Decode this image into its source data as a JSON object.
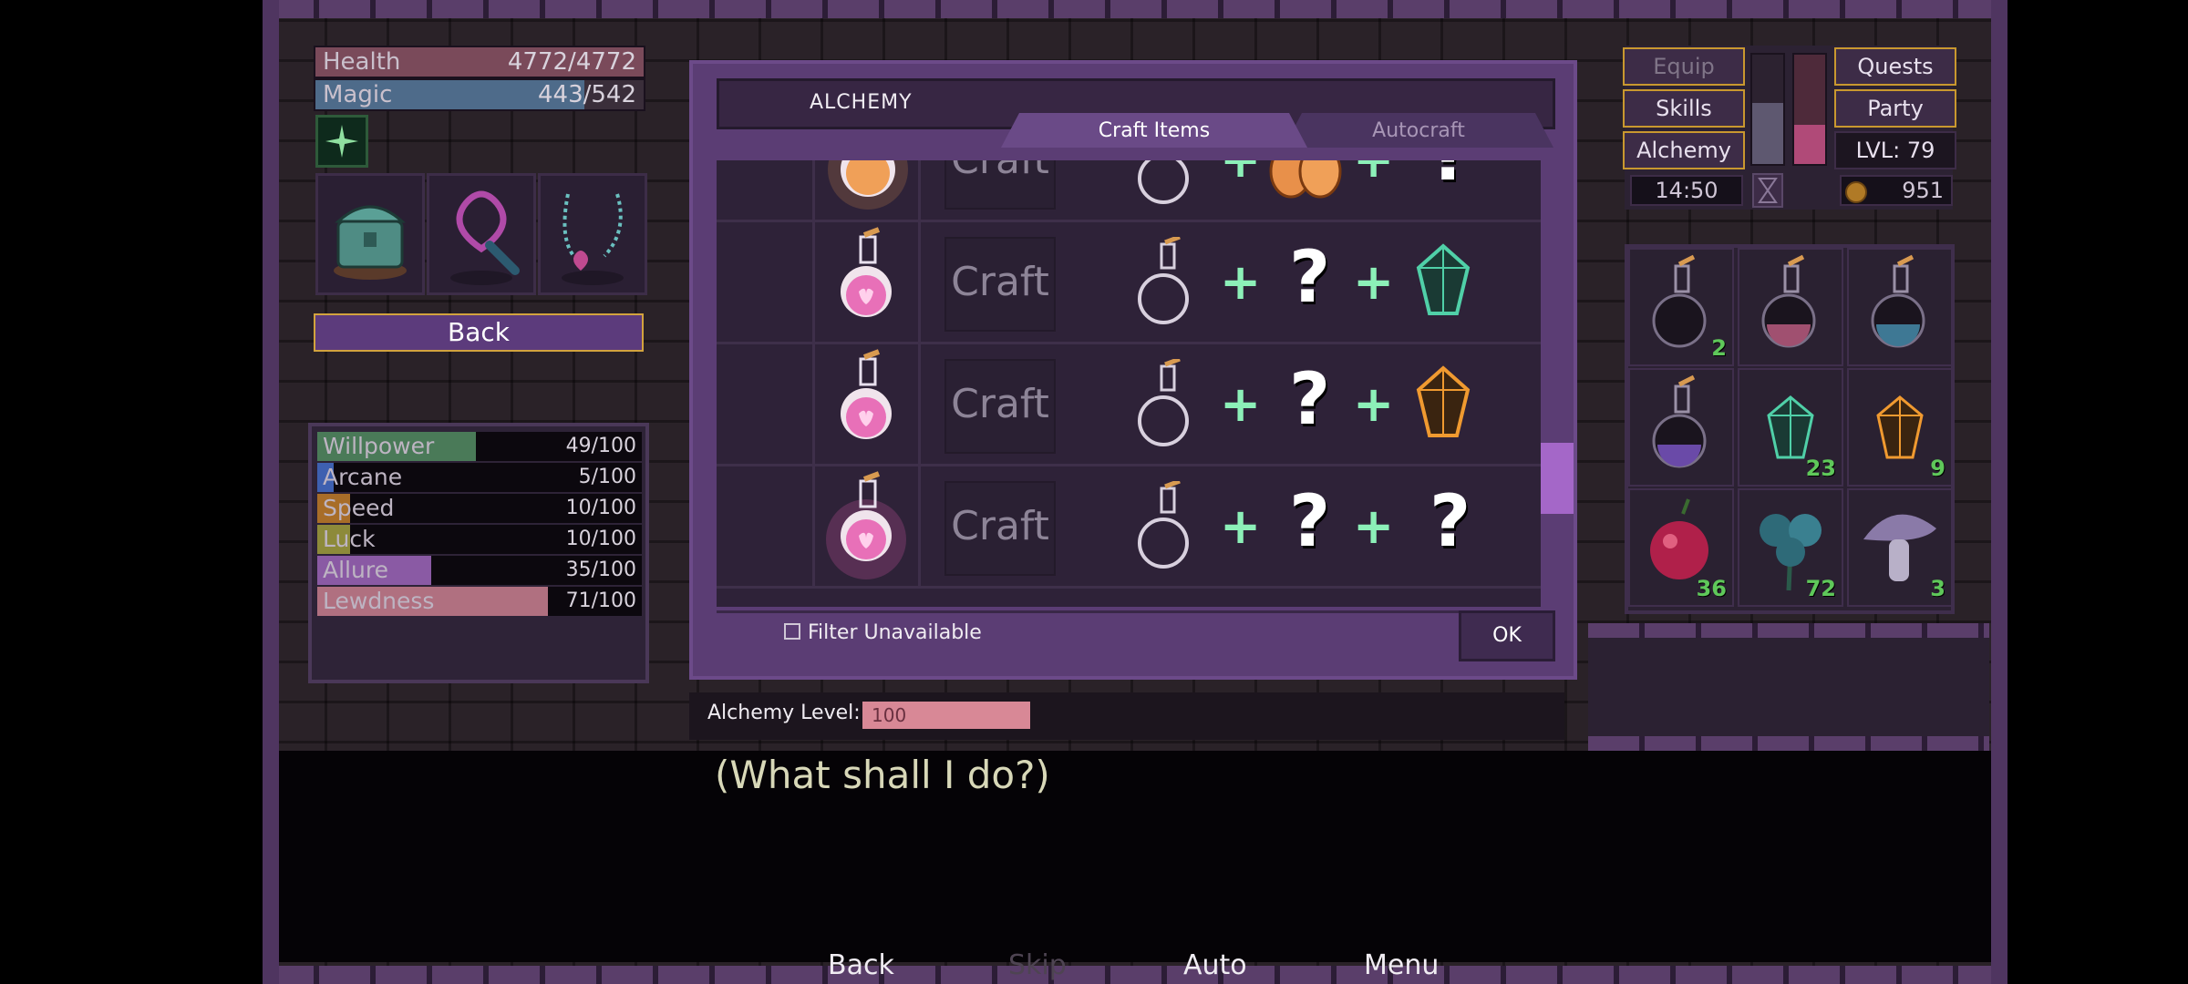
{
  "status": {
    "health": {
      "label": "Health",
      "value": "4772/4772",
      "fill": 1.0
    },
    "magic": {
      "label": "Magic",
      "value": "443/542",
      "fill": 0.82
    }
  },
  "left_panel": {
    "back_label": "Back",
    "equipment": [
      "treasure-chest",
      "heart-collar",
      "heart-necklace"
    ]
  },
  "stats": [
    {
      "label": "Willpower",
      "value": "49/100",
      "fill": 0.49,
      "color": "#4a7a58"
    },
    {
      "label": "Arcane",
      "value": "5/100",
      "fill": 0.05,
      "color": "#3e60b0"
    },
    {
      "label": "Speed",
      "value": "10/100",
      "fill": 0.1,
      "color": "#a86d28"
    },
    {
      "label": "Luck",
      "value": "10/100",
      "fill": 0.1,
      "color": "#8d8a3a"
    },
    {
      "label": "Allure",
      "value": "35/100",
      "fill": 0.35,
      "color": "#8a5aa4"
    },
    {
      "label": "Lewdness",
      "value": "71/100",
      "fill": 0.71,
      "color": "#b07080"
    }
  ],
  "alchemy": {
    "title": "ALCHEMY",
    "tabs": {
      "active": "Craft Items",
      "inactive": "Autocraft"
    },
    "recipes": [
      {
        "craft_label": "Craft",
        "ingredients": [
          "empty-flask-icon",
          "orange-eggs-icon",
          "?"
        ]
      },
      {
        "craft_label": "Craft",
        "ingredients": [
          "empty-flask-icon",
          "?",
          "teal-crystal-icon"
        ]
      },
      {
        "craft_label": "Craft",
        "ingredients": [
          "empty-flask-icon",
          "?",
          "orange-crystal-icon"
        ]
      },
      {
        "craft_label": "Craft",
        "ingredients": [
          "empty-flask-icon",
          "?",
          "?"
        ]
      }
    ],
    "plus": "+",
    "question": "?",
    "filter_label": "Filter Unavailable",
    "ok_label": "OK",
    "level_label": "Alchemy Level:",
    "level_value": "100"
  },
  "right_menu": {
    "equip": "Equip",
    "skills": "Skills",
    "alchemy": "Alchemy",
    "quests": "Quests",
    "party": "Party",
    "level": "LVL: 79",
    "time": "14:50",
    "gold": "951"
  },
  "inventory": [
    {
      "item": "empty-potion",
      "count": "2"
    },
    {
      "item": "pink-potion",
      "count": ""
    },
    {
      "item": "blue-potion",
      "count": ""
    },
    {
      "item": "purple-potion",
      "count": ""
    },
    {
      "item": "teal-crystal",
      "count": "23"
    },
    {
      "item": "orange-crystal",
      "count": "9"
    },
    {
      "item": "red-fruit",
      "count": "36"
    },
    {
      "item": "blue-flower",
      "count": "72"
    },
    {
      "item": "mushroom",
      "count": "3"
    }
  ],
  "dialogue": {
    "text": "(What shall I do?)"
  },
  "quick_menu": {
    "back": "Back",
    "skip": "Skip",
    "auto": "Auto",
    "menu": "Menu"
  }
}
